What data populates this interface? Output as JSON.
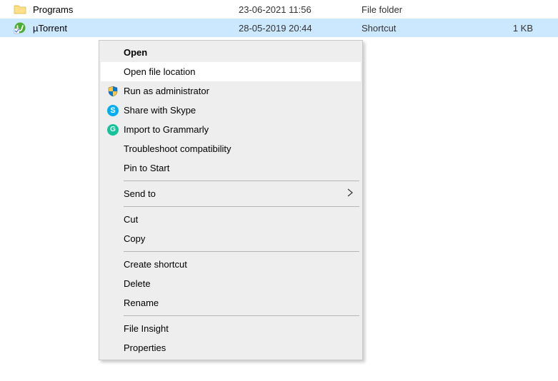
{
  "files": [
    {
      "name": "Programs",
      "date": "23-06-2021 11:56",
      "type": "File folder",
      "size": "",
      "icon": "folder"
    },
    {
      "name": "µTorrent",
      "date": "28-05-2019 20:44",
      "type": "Shortcut",
      "size": "1 KB",
      "icon": "utorrent",
      "selected": true
    }
  ],
  "menu": {
    "open": "Open",
    "open_file_location": "Open file location",
    "run_as_admin": "Run as administrator",
    "share_skype": "Share with Skype",
    "import_grammarly": "Import to Grammarly",
    "troubleshoot": "Troubleshoot compatibility",
    "pin_start": "Pin to Start",
    "send_to": "Send to",
    "cut": "Cut",
    "copy": "Copy",
    "create_shortcut": "Create shortcut",
    "delete": "Delete",
    "rename": "Rename",
    "file_insight": "File Insight",
    "properties": "Properties"
  }
}
